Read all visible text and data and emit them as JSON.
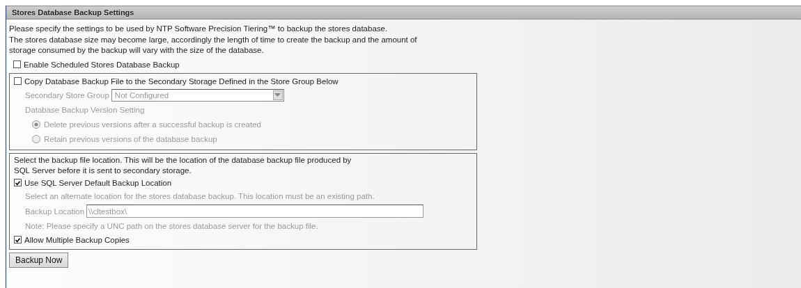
{
  "panel": {
    "title": "Stores Database Backup Settings",
    "intro": [
      "Please specify the settings to be used by NTP Software Precision Tiering™ to backup the stores database.",
      "The stores database size may become large, accordingly the length of time to create the backup and the amount of",
      "storage consumed by the backup will vary with the size of the database."
    ],
    "enable_scheduled": {
      "label": "Enable Scheduled Stores Database Backup",
      "checked": false
    },
    "copy_section": {
      "checkbox": {
        "label": "Copy Database Backup File to the Secondary Storage Defined in the Store Group Below",
        "checked": false
      },
      "store_group": {
        "label": "Secondary Store Group",
        "value": "Not Configured"
      },
      "version_heading": "Database Backup Version Setting",
      "options": [
        {
          "label": "Delete previous versions after a successful backup is created",
          "selected": true
        },
        {
          "label": "Retain previous versions of the database backup",
          "selected": false
        }
      ]
    },
    "location_section": {
      "intro": [
        "Select the backup file location. This will be the location of the database backup file produced by",
        "SQL Server before it is sent to secondary storage."
      ],
      "use_default": {
        "label": "Use SQL Server Default Backup Location",
        "checked": true
      },
      "hint": "Select an alternate location for the stores database backup. This location must be an existing path.",
      "backup_location": {
        "label": "Backup Location",
        "value": "\\\\cltestbox\\"
      },
      "note": "Note: Please specify a UNC path on the stores database server for the backup file.",
      "allow_multiple": {
        "label": "Allow Multiple Backup Copies",
        "checked": true
      }
    },
    "button": "Backup Now"
  }
}
